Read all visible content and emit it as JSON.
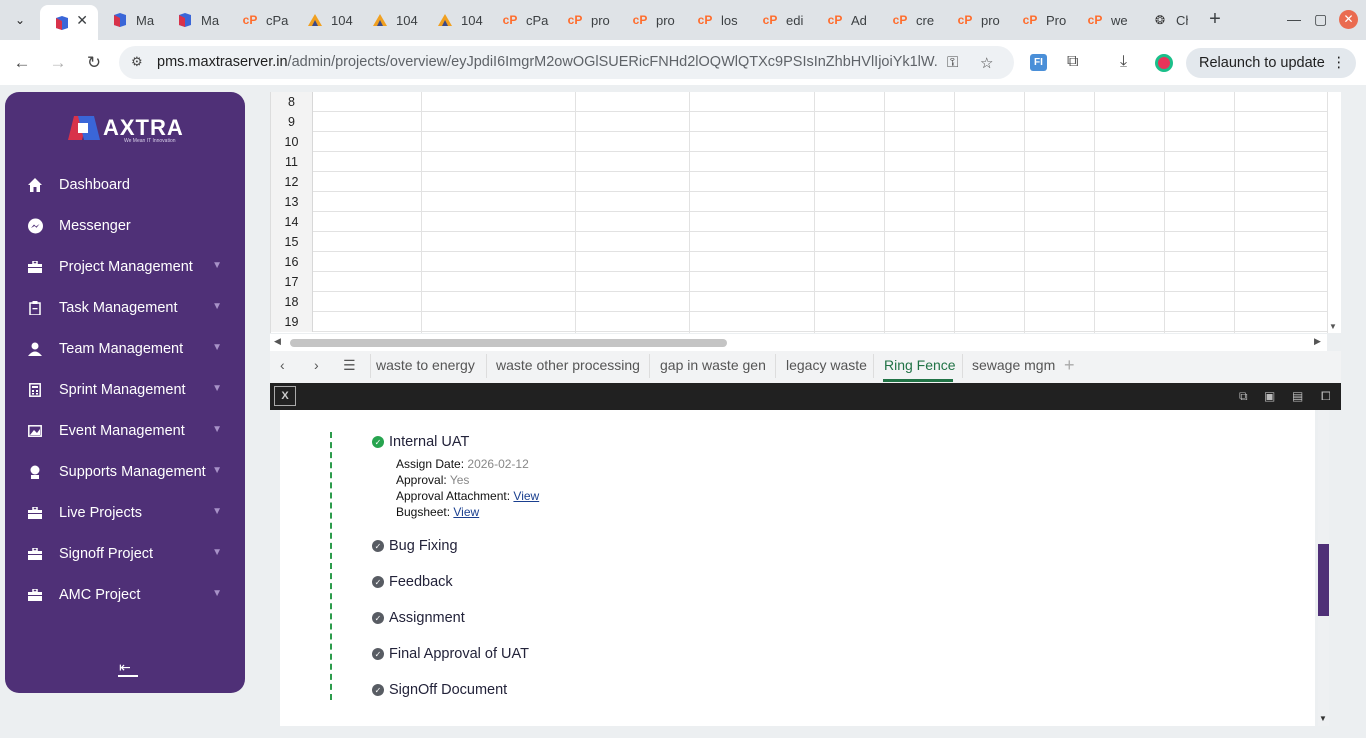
{
  "browser": {
    "tabs": [
      {
        "label": "",
        "icon": "maxtra-icon",
        "active": true
      },
      {
        "label": "Ma",
        "icon": "maxtra-icon"
      },
      {
        "label": "Ma",
        "icon": "maxtra-icon"
      },
      {
        "label": "cPa",
        "icon": "cpanel-icon"
      },
      {
        "label": "104",
        "icon": "mountain-icon"
      },
      {
        "label": "104",
        "icon": "mountain-icon"
      },
      {
        "label": "104",
        "icon": "mountain-icon"
      },
      {
        "label": "cPa",
        "icon": "cpanel-icon"
      },
      {
        "label": "pro",
        "icon": "cpanel-icon"
      },
      {
        "label": "pro",
        "icon": "cpanel-icon"
      },
      {
        "label": "los",
        "icon": "cpanel-icon"
      },
      {
        "label": "edi",
        "icon": "cpanel-icon"
      },
      {
        "label": "Ad",
        "icon": "cpanel-icon"
      },
      {
        "label": "cre",
        "icon": "cpanel-icon"
      },
      {
        "label": "pro",
        "icon": "cpanel-icon"
      },
      {
        "label": "Pro",
        "icon": "cpanel-icon"
      },
      {
        "label": "we",
        "icon": "cpanel-icon"
      },
      {
        "label": "Ch",
        "icon": "chatgpt-icon"
      }
    ],
    "url_host": "pms.maxtraserver.in",
    "url_path": "/admin/projects/overview/eyJpdiI6ImgrM2owOGlSUERicFNHd2lOQWlQTXc9PSIsInZhbHVlIjoiYk1lW...",
    "relaunch_label": "Relaunch to update",
    "colors": {
      "accent_cpanel": "#ff6c2c",
      "profile": "#e8345a"
    }
  },
  "sidebar": {
    "logo_text": "AXTRA",
    "logo_tagline": "We Mean IT Innovation",
    "items": [
      {
        "label": "Dashboard",
        "icon": "home-icon",
        "dropdown": false
      },
      {
        "label": "Messenger",
        "icon": "messenger-icon",
        "dropdown": false
      },
      {
        "label": "Project Management",
        "icon": "briefcase-icon",
        "dropdown": true
      },
      {
        "label": "Task Management",
        "icon": "clipboard-icon",
        "dropdown": true
      },
      {
        "label": "Team Management",
        "icon": "user-icon",
        "dropdown": true
      },
      {
        "label": "Sprint Management",
        "icon": "calculator-icon",
        "dropdown": true
      },
      {
        "label": "Event Management",
        "icon": "image-icon",
        "dropdown": true
      },
      {
        "label": "Supports Management",
        "icon": "support-icon",
        "dropdown": true
      },
      {
        "label": "Live Projects",
        "icon": "briefcase-icon",
        "dropdown": true
      },
      {
        "label": "Signoff Project",
        "icon": "briefcase-icon",
        "dropdown": true
      },
      {
        "label": "AMC Project",
        "icon": "briefcase-icon",
        "dropdown": true
      }
    ],
    "colors": {
      "background": "#4f3077"
    }
  },
  "spreadsheet": {
    "row_numbers": [
      "8",
      "9",
      "10",
      "11",
      "12",
      "13",
      "14",
      "15",
      "16",
      "17",
      "18",
      "19"
    ],
    "sheet_tabs": [
      {
        "label": "waste to energy"
      },
      {
        "label": "waste other processing"
      },
      {
        "label": "gap in waste gen"
      },
      {
        "label": "legacy waste"
      },
      {
        "label": "Ring Fence",
        "active": true
      },
      {
        "label": "sewage mgm"
      }
    ],
    "colors": {
      "active_tab": "#217346"
    }
  },
  "timeline": {
    "steps": [
      {
        "label": "Internal UAT",
        "status": "done"
      },
      {
        "label": "Bug Fixing",
        "status": "pending"
      },
      {
        "label": "Feedback",
        "status": "pending"
      },
      {
        "label": "Assignment",
        "status": "pending"
      },
      {
        "label": "Final Approval of UAT",
        "status": "pending"
      },
      {
        "label": "SignOff Document",
        "status": "pending"
      }
    ],
    "details": {
      "assign_date_label": "Assign Date:",
      "assign_date_value": "2026-02-12",
      "approval_label": "Approval:",
      "approval_value": "Yes",
      "attachment_label": "Approval Attachment:",
      "attachment_link": "View",
      "bugsheet_label": "Bugsheet:",
      "bugsheet_link": "View"
    },
    "colors": {
      "done": "#27a44f",
      "pending": "#585c63",
      "line": "#2c9b4b"
    }
  }
}
